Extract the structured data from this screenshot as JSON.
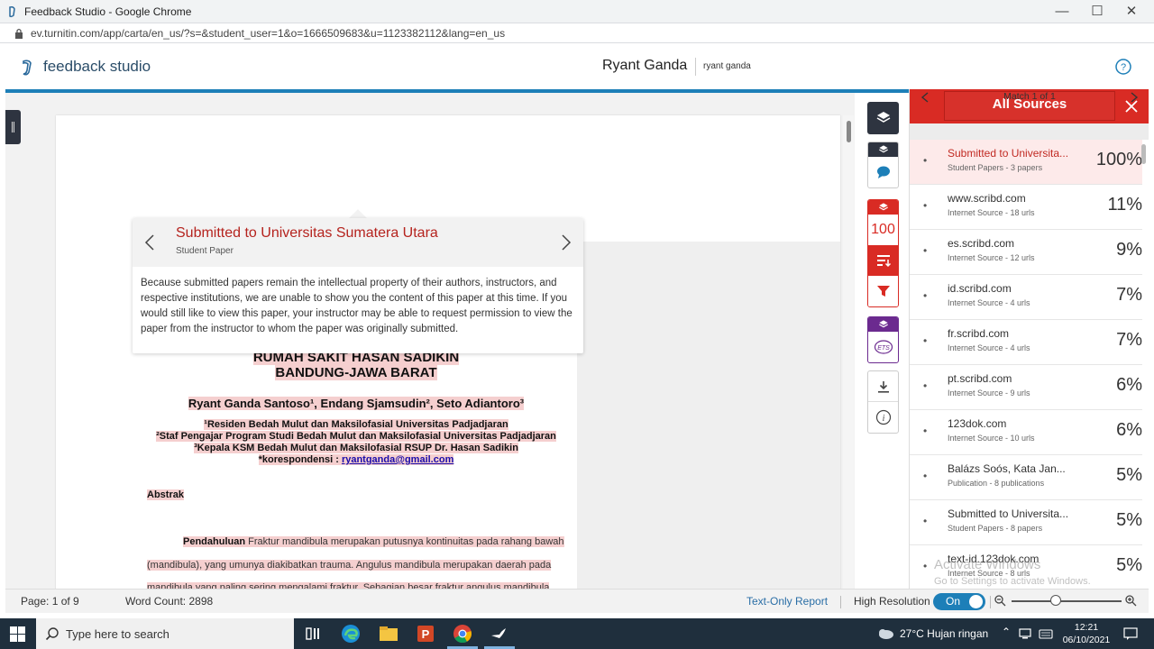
{
  "window": {
    "title": "Feedback Studio - Google Chrome",
    "url": "ev.turnitin.com/app/carta/en_us/?s=&student_user=1&o=1666509683&u=1123382112&lang=en_us"
  },
  "header": {
    "logo_text": "feedback studio",
    "user_name": "Ryant Ganda",
    "user_sub": "ryant ganda"
  },
  "popup": {
    "title": "Submitted to Universitas Sumatera Utara",
    "subtitle": "Student Paper",
    "body": "Because submitted papers remain the intellectual property of their authors, instructors, and respective institutions, we are unable to show you the content of this paper at this time. If you would still like to view this paper, your instructor may be able to request permission to view the paper from the instructor to whom the paper was originally submitted."
  },
  "document": {
    "title_line1": "RUMAH SAKIT HASAN SADIKIN",
    "title_line2": "BANDUNG-JAWA BARAT",
    "authors": "Ryant Ganda Santoso¹, Endang Sjamsudin², Seto Adiantoro³",
    "affiliation1": "¹Residen Bedah Mulut dan Maksilofasial Universitas Padjadjaran",
    "affiliation2": "²Staf Pengajar Program Studi Bedah Mulut dan Maksilofasial Universitas Padjadjaran",
    "affiliation3": "³Kepala KSM Bedah Mulut dan Maksilofasial RSUP Dr. Hasan Sadikin",
    "correspondence_label": "*korespondensi : ",
    "correspondence_email": "ryantganda@gmail.com",
    "abstract_heading": "Abstrak",
    "para1_bold": "Pendahuluan",
    "para1_text": " Fraktur mandibula merupakan putusnya kontinuitas pada rahang bawah",
    "para2_text": "(mandibula), yang umunya diakibatkan trauma. Angulus mandibula merupakan daerah pada",
    "para3_text": "mandibula yang paling sering mengalami fraktur. Sebagian besar fraktur angulus mandibula"
  },
  "rail": {
    "score": "100"
  },
  "sources_panel": {
    "title": "All Sources",
    "match_text": "Match 1 of 1",
    "sources": [
      {
        "name": "Submitted to Universita...",
        "type": "Student Papers - 3 papers",
        "percent": "100%"
      },
      {
        "name": "www.scribd.com",
        "type": "Internet Source - 18 urls",
        "percent": "11%"
      },
      {
        "name": "es.scribd.com",
        "type": "Internet Source - 12 urls",
        "percent": "9%"
      },
      {
        "name": "id.scribd.com",
        "type": "Internet Source - 4 urls",
        "percent": "7%"
      },
      {
        "name": "fr.scribd.com",
        "type": "Internet Source - 4 urls",
        "percent": "7%"
      },
      {
        "name": "pt.scribd.com",
        "type": "Internet Source - 9 urls",
        "percent": "6%"
      },
      {
        "name": "123dok.com",
        "type": "Internet Source - 10 urls",
        "percent": "6%"
      },
      {
        "name": "Balázs Soós, Kata Jan...",
        "type": "Publication - 8 publications",
        "percent": "5%"
      },
      {
        "name": "Submitted to Universita...",
        "type": "Student Papers - 8 papers",
        "percent": "5%"
      },
      {
        "name": "text-id.123dok.com",
        "type": "Internet Source - 8 urls",
        "percent": "5%"
      }
    ],
    "watermark_line1": "Activate Windows",
    "watermark_line2": "Go to Settings to activate Windows."
  },
  "status": {
    "page": "Page: 1 of 9",
    "word_count": "Word Count: 2898",
    "text_only": "Text-Only Report",
    "high_res": "High Resolution",
    "toggle": "On"
  },
  "taskbar": {
    "search_placeholder": "Type here to search",
    "weather": "27°C  Hujan ringan",
    "time": "12:21",
    "date": "06/10/2021"
  },
  "colors": {
    "accent_blue": "#1d7fb8",
    "match_red": "#d92b24",
    "dark_rail": "#2e3440",
    "purple": "#6b2a8f",
    "highlight": "#f5cfcf"
  }
}
